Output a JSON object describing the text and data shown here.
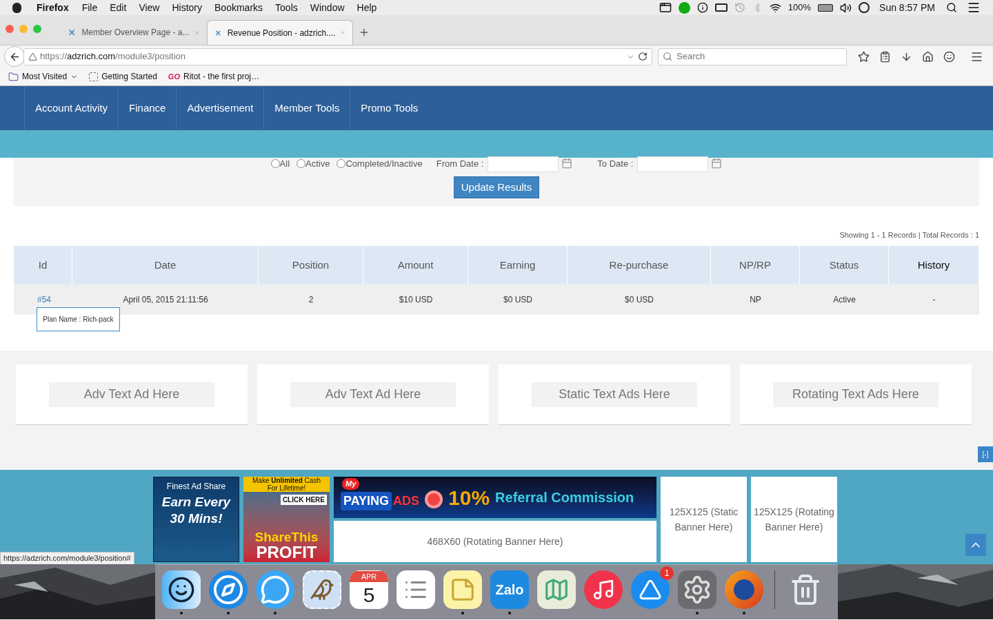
{
  "menubar": {
    "app": "Firefox",
    "menus": [
      "File",
      "Edit",
      "View",
      "History",
      "Bookmarks",
      "Tools",
      "Window",
      "Help"
    ],
    "battery": "100%",
    "clock": "Sun 8:57 PM"
  },
  "tabs": [
    {
      "title": "Member Overview Page - a...",
      "selected": false
    },
    {
      "title": "Revenue Position - adzrich....",
      "selected": true
    }
  ],
  "address": {
    "scheme": "https://",
    "domain": "adzrich.com",
    "path": "/module3/position"
  },
  "search": {
    "placeholder": "Search"
  },
  "bookmarks": [
    {
      "kind": "folder",
      "label": "Most Visited"
    },
    {
      "kind": "page",
      "label": "Getting Started"
    },
    {
      "kind": "logo",
      "badge": "GO",
      "label": "Ritot - the first proj…"
    }
  ],
  "nav": [
    "Account Activity",
    "Finance",
    "Advertisement",
    "Member Tools",
    "Promo Tools"
  ],
  "filters": {
    "radios": [
      {
        "label": "All",
        "selected": false
      },
      {
        "label": "Active",
        "selected": false
      },
      {
        "label": "Completed/Inactive",
        "selected": false
      }
    ],
    "from_label": "From Date :",
    "to_label": "To Date :",
    "button": "Update Results"
  },
  "summary": "Showing 1 - 1 Records | Total Records : 1",
  "table": {
    "columns": [
      "Id",
      "Date",
      "Position",
      "Amount",
      "Earning",
      "Re-purchase",
      "NP/RP",
      "Status",
      "History"
    ],
    "rows": [
      {
        "cells": [
          "#54",
          "April 05, 2015 21:11:56",
          "2",
          "$10 USD",
          "$0 USD",
          "$0 USD",
          "NP",
          "Active",
          "-"
        ],
        "tooltip": "Plan Name : Rich-pack"
      }
    ]
  },
  "ad_cards": [
    "Adv Text Ad Here",
    "Adv Text Ad Here",
    "Static Text Ads Here",
    "Rotating Text Ads Here"
  ],
  "collapse": "[-]",
  "banners": {
    "earn": {
      "brand": "Finest Ad Share",
      "text": "Earn Every 30 Mins!"
    },
    "profit": {
      "top": "Make",
      "bold": "Unlimited",
      "rest": "Cash",
      "line2": "For Lifetime!",
      "cta": "CLICK HERE",
      "title1": "ShareThis",
      "title2": "PROFIT"
    },
    "leaderboard": {
      "tag": "My",
      "brand1": "PAYING",
      "brand2": "ADS",
      "percent": "10%",
      "offer": "Referral Commission"
    },
    "wide_slot": "468X60 (Rotating Banner Here)",
    "squares": [
      "125X125 (Static Banner Here)",
      "125X125 (Rotating Banner Here)"
    ]
  },
  "status_url": "https://adzrich.com/module3/position#",
  "dock": [
    {
      "kind": "finder",
      "running": true
    },
    {
      "kind": "safari",
      "running": true
    },
    {
      "kind": "messages",
      "running": true
    },
    {
      "kind": "mail",
      "running": false
    },
    {
      "kind": "calendar",
      "month": "APR",
      "day": "5",
      "running": false
    },
    {
      "kind": "reminders",
      "running": false
    },
    {
      "kind": "notes",
      "running": true
    },
    {
      "kind": "zalo",
      "label": "Zalo",
      "running": true
    },
    {
      "kind": "maps",
      "running": false
    },
    {
      "kind": "music",
      "running": false
    },
    {
      "kind": "appstore",
      "badge": "1",
      "running": false
    },
    {
      "kind": "settings",
      "running": true
    },
    {
      "kind": "firefox",
      "running": true
    },
    {
      "kind": "trash",
      "running": false
    }
  ]
}
